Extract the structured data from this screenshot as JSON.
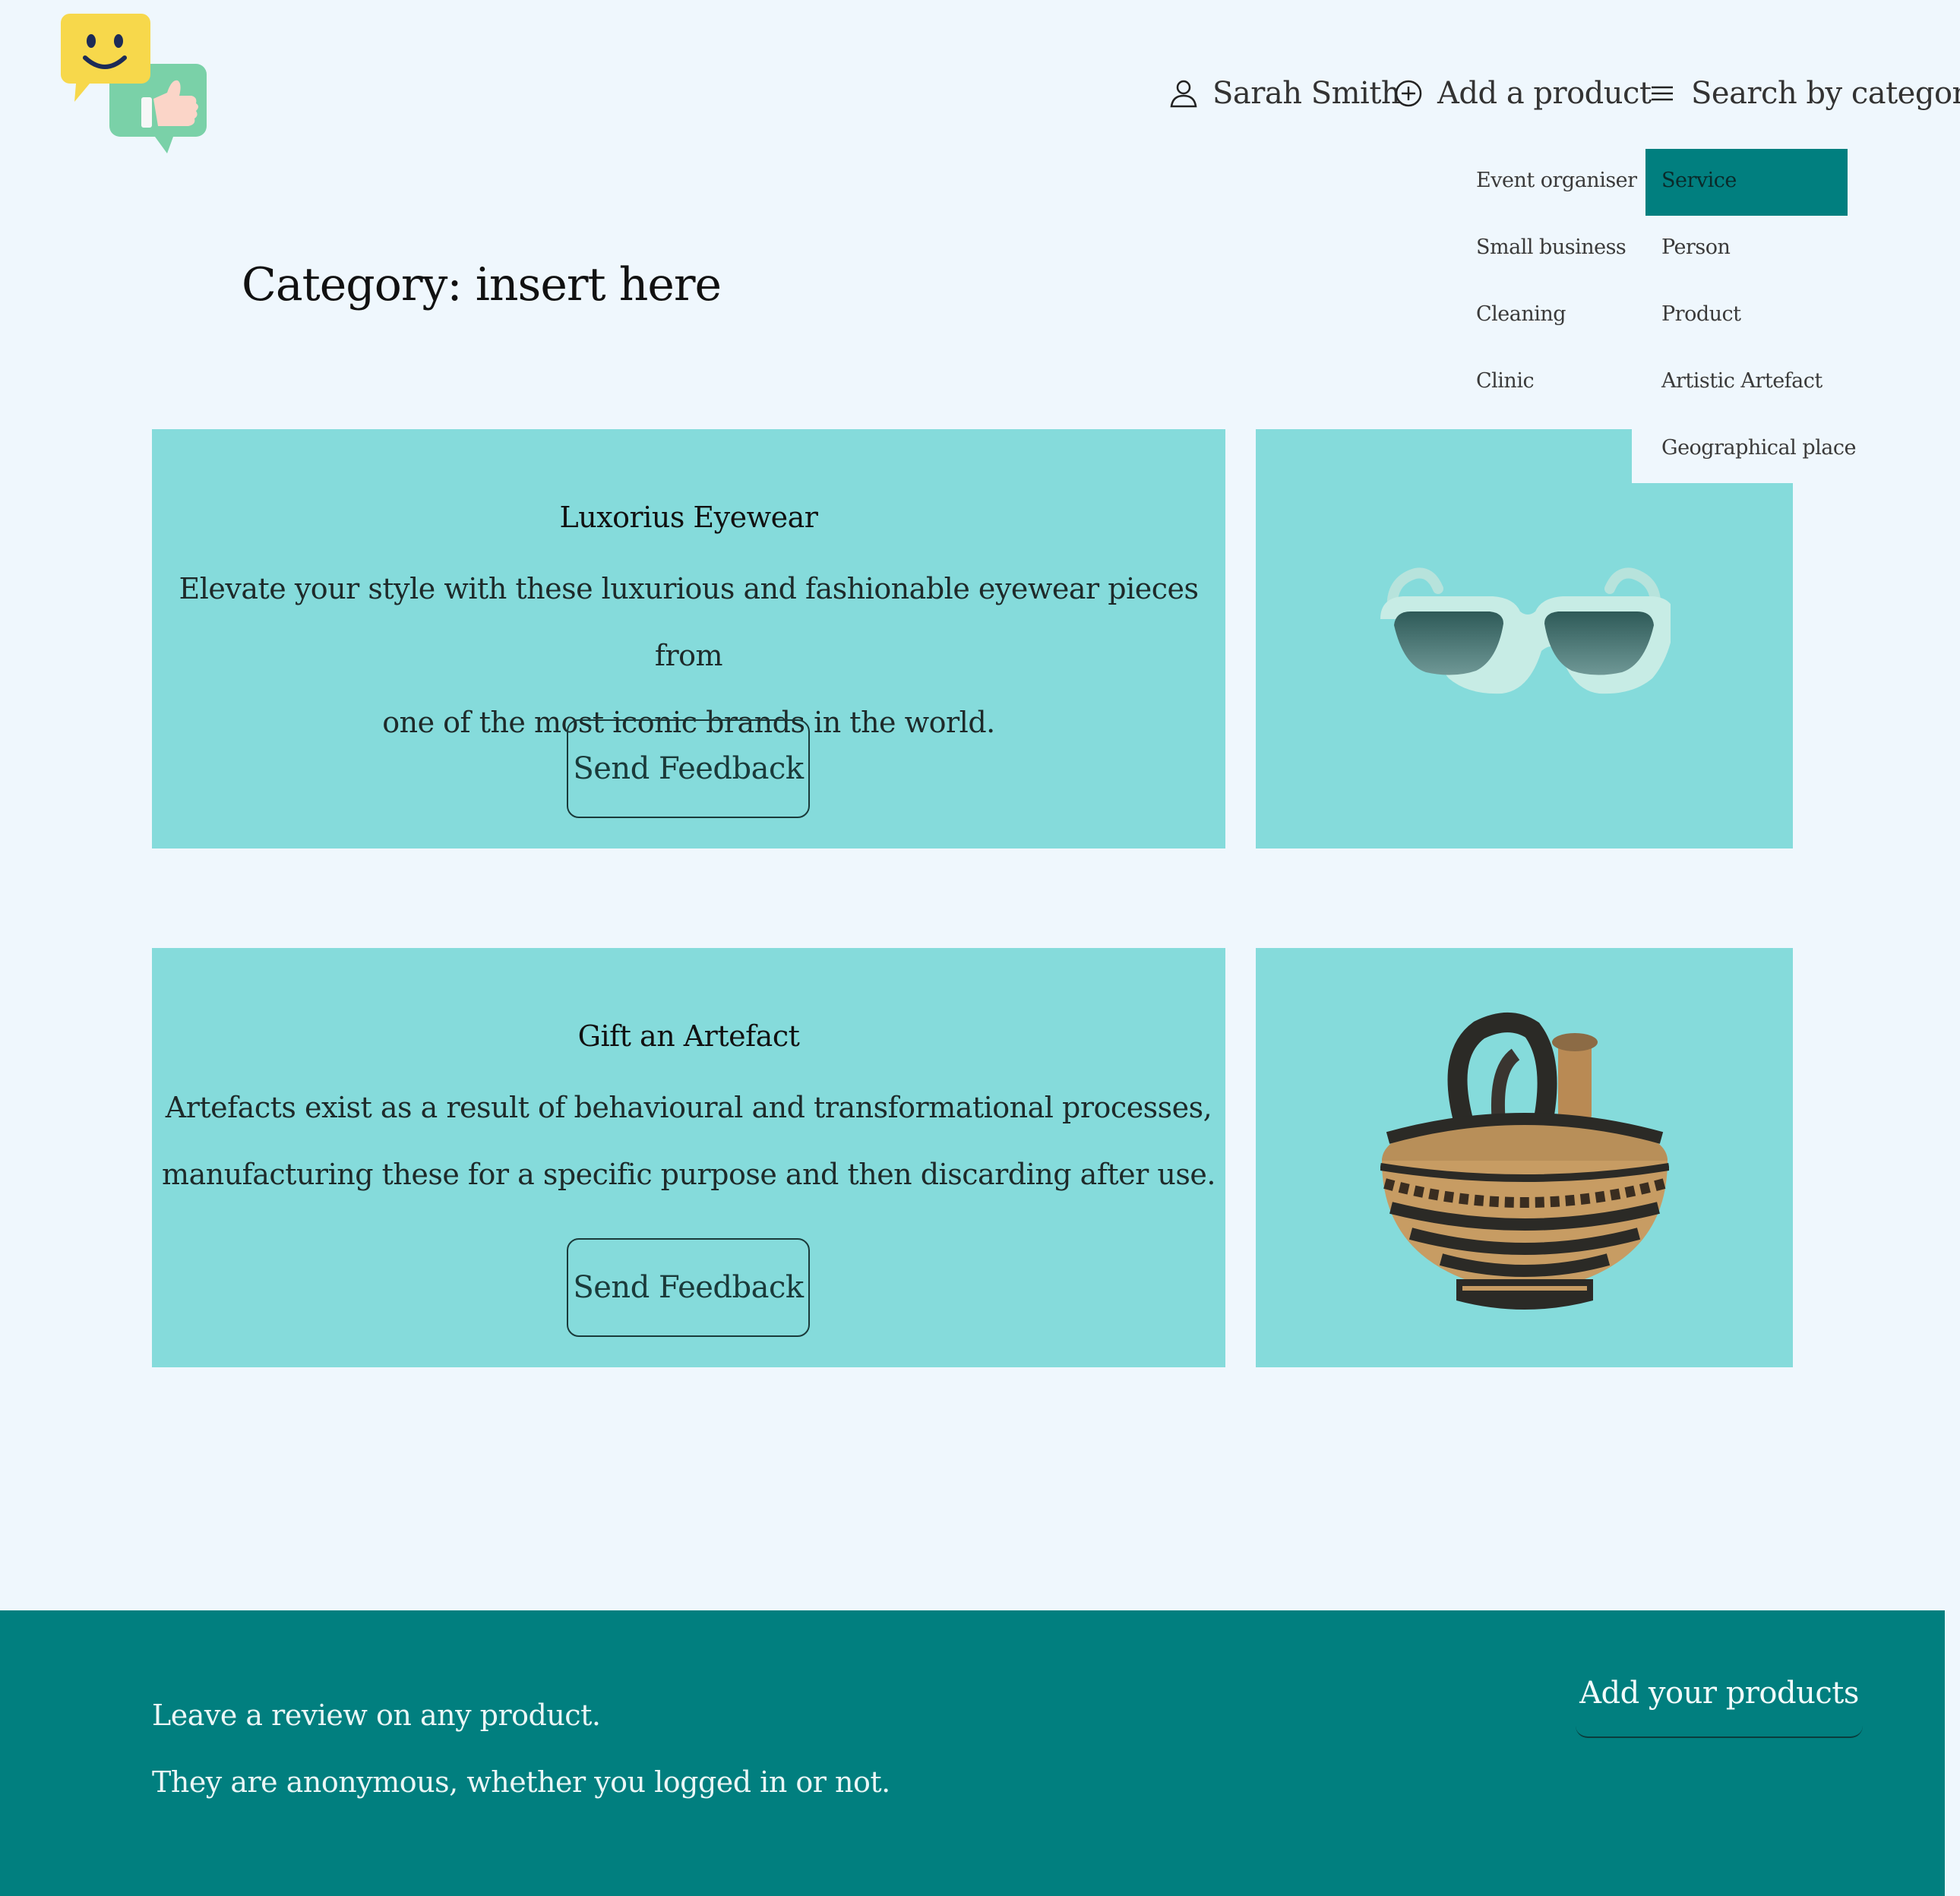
{
  "header": {
    "user_name": "Sarah Smith",
    "add_product_label": "Add a product",
    "search_category_label": "Search by category"
  },
  "dropdown": {
    "left_column": [
      "Event organiser",
      "Small business",
      "Cleaning",
      "Clinic"
    ],
    "right_column": [
      "Service",
      "Person",
      "Product",
      "Artistic Artefact",
      "Geographical place"
    ],
    "active_item": "Service"
  },
  "page": {
    "title": "Category: insert here"
  },
  "products": [
    {
      "title": "Luxorius Eyewear",
      "description_line1": "Elevate your style with these luxurious and fashionable eyewear pieces from",
      "description_line2": "one of the most iconic brands in the world.",
      "button_label": "Send Feedback",
      "image": "sunglasses"
    },
    {
      "title": "Gift an Artefact",
      "description_line1": "Artefacts exist as a result of behavioural and transformational processes,",
      "description_line2": "manufacturing these for a specific purpose and then discarding after use.",
      "button_label": "Send Feedback",
      "image": "ancient-vase"
    }
  ],
  "footer": {
    "line1": "Leave a review on any product.",
    "line2": "They are anonymous, whether you logged in or not.",
    "button_label": "Add your products"
  },
  "colors": {
    "background": "#eff7fd",
    "card": "#85dbdb",
    "accent": "#017f7f"
  }
}
